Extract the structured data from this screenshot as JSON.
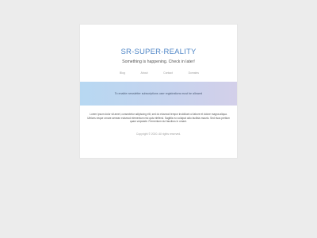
{
  "header": {
    "title": "SR-SUPER-REALITY",
    "tagline": "Something is happening. Check in later!"
  },
  "nav": {
    "items": [
      {
        "label": "Blog"
      },
      {
        "label": "About"
      },
      {
        "label": "Contact"
      },
      {
        "label": "Domains"
      }
    ]
  },
  "banner": {
    "text": "To enable newsletter subscriptions user registrations must be allowed"
  },
  "main": {
    "body": "Lorem ipsum dolor sit amet, consectetur adipiscing elit, sed do eiusmod tempor incididunt ut labore et dolore magna aliqua. Ultrices neque ornare aenean euismod elementum nisi quis eleifend. Sagittis eu volutpat odio facilisis mauris. Sed risus pretium quam vulputate. Fermentum dui faucibus in ornare."
  },
  "footer": {
    "copyright": "Copyright © 2020. All rights reserved."
  },
  "colors": {
    "page_background": "#ececec",
    "card_background": "#ffffff",
    "title": "#4f86c6",
    "banner_start": "#b7d8f2",
    "banner_end": "#d3cfe9"
  }
}
